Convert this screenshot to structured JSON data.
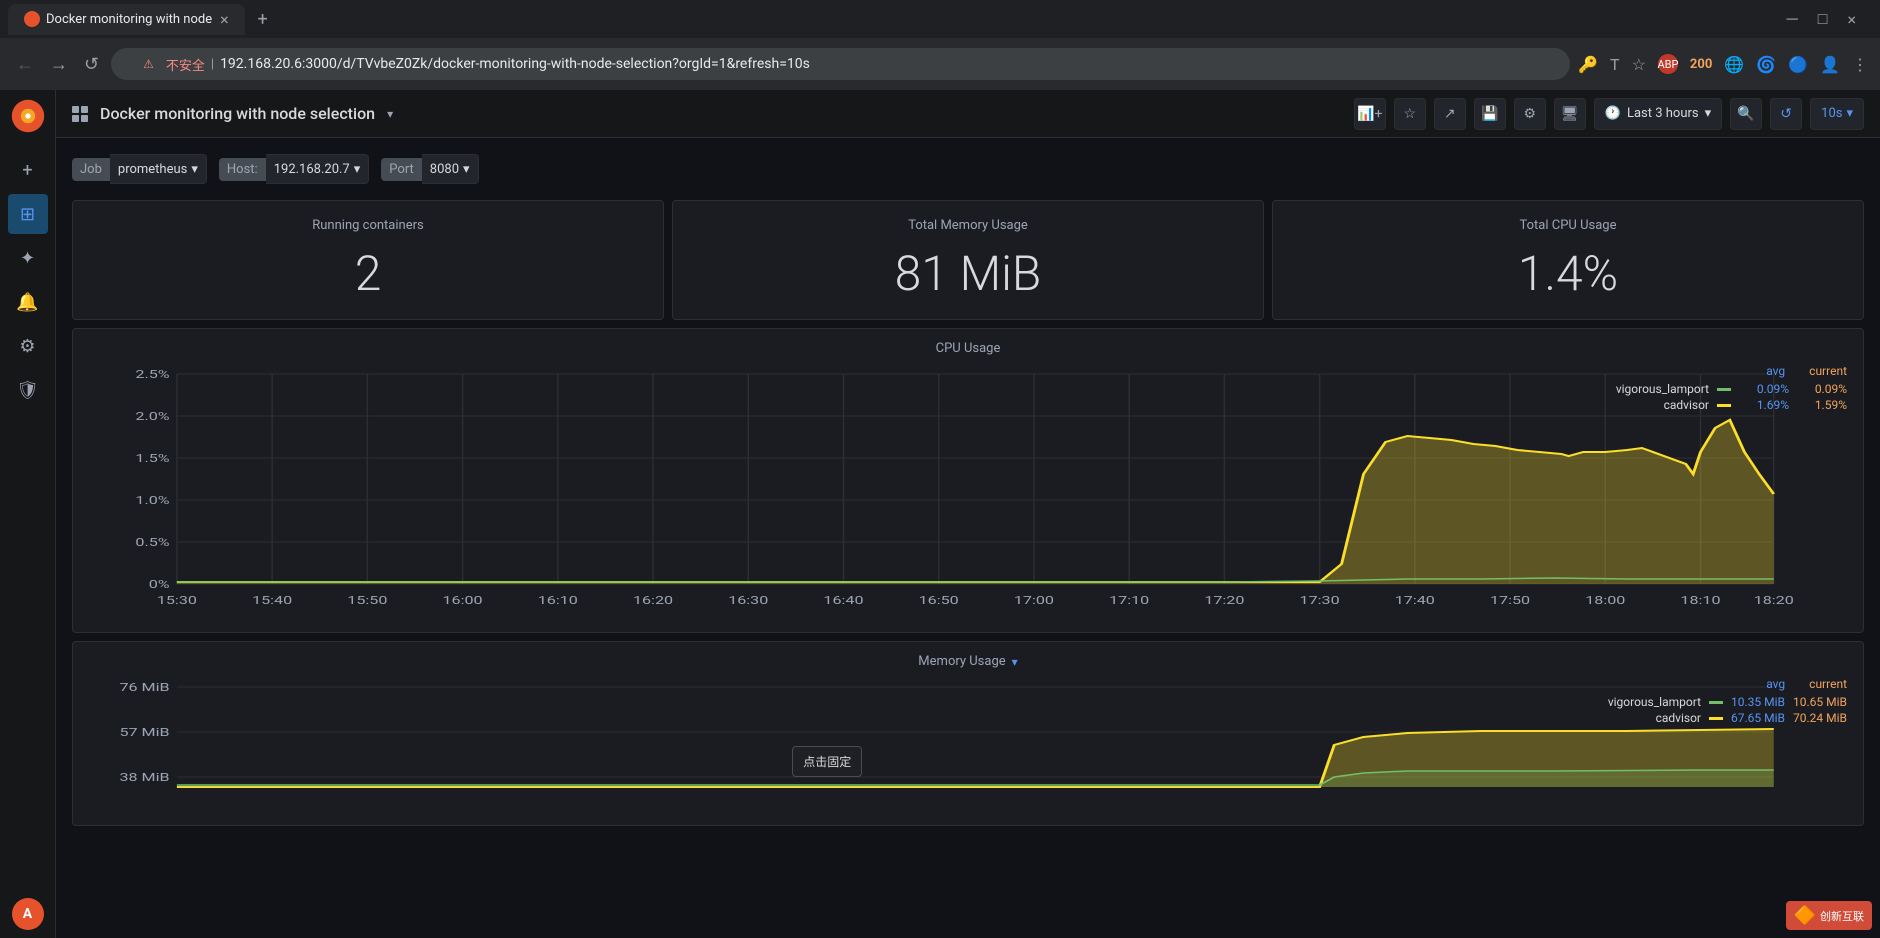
{
  "browser": {
    "tab_title": "Docker monitoring with node",
    "tab_favicon": "●",
    "address_bar": "192.168.20.6:3000/d/TVvbeZ0Zk/docker-monitoring-with-node-selection?orgId=1&refresh=10s",
    "address_warning": "⚠",
    "address_prefix": "不安全",
    "nav_back": "←",
    "nav_forward": "→",
    "nav_reload": "↺"
  },
  "grafana": {
    "logo": "○",
    "dashboard_title": "Docker monitoring with node selection",
    "time_range": "Last 3 hours",
    "refresh_interval": "10s"
  },
  "toolbar": {
    "add_panel_label": "+",
    "star_label": "☆",
    "share_label": "⎤",
    "save_label": "💾",
    "settings_label": "⚙",
    "monitor_label": "🖥",
    "search_label": "🔍",
    "clock_icon": "🕐"
  },
  "variables": {
    "job_label": "Job",
    "job_value": "prometheus",
    "host_label": "Host:",
    "host_value": "192.168.20.7",
    "port_label": "Port",
    "port_value": "8080"
  },
  "stats": {
    "running_containers_title": "Running containers",
    "running_containers_value": "2",
    "memory_usage_title": "Total Memory Usage",
    "memory_usage_value": "81 MiB",
    "cpu_usage_title": "Total CPU Usage",
    "cpu_usage_value": "1.4%"
  },
  "cpu_chart": {
    "title": "CPU Usage",
    "y_labels": [
      "2.5%",
      "2.0%",
      "1.5%",
      "1.0%",
      "0.5%",
      "0%"
    ],
    "x_labels": [
      "15:30",
      "15:40",
      "15:50",
      "16:00",
      "16:10",
      "16:20",
      "16:30",
      "16:40",
      "16:50",
      "17:00",
      "17:10",
      "17:20",
      "17:30",
      "17:40",
      "17:50",
      "18:00",
      "18:10",
      "18:20"
    ],
    "legend": {
      "avg_label": "avg",
      "current_label": "current",
      "series": [
        {
          "name": "vigorous_lamport",
          "color": "green",
          "avg": "0.09%",
          "current": "0.09%"
        },
        {
          "name": "cadvisor",
          "color": "yellow",
          "avg": "1.69%",
          "current": "1.59%"
        }
      ]
    }
  },
  "memory_chart": {
    "title": "Memory Usage",
    "y_labels": [
      "76 MiB",
      "57 MiB",
      "38 MiB"
    ],
    "legend": {
      "avg_label": "avg",
      "current_label": "current",
      "series": [
        {
          "name": "vigorous_lamport",
          "color": "green",
          "avg": "10.35 MiB",
          "current": "10.65 MiB"
        },
        {
          "name": "cadvisor",
          "color": "yellow",
          "avg": "67.65 MiB",
          "current": "70.24 MiB"
        }
      ]
    }
  },
  "sidebar": {
    "items": [
      {
        "label": "Add panel",
        "icon": "+"
      },
      {
        "label": "Dashboard",
        "icon": "⊞"
      },
      {
        "label": "Explore",
        "icon": "✦"
      },
      {
        "label": "Alerting",
        "icon": "🔔"
      },
      {
        "label": "Configuration",
        "icon": "⚙"
      },
      {
        "label": "Shield",
        "icon": "🛡"
      }
    ]
  },
  "watermark": {
    "text": "创新互联"
  },
  "tooltip": {
    "text": "点击固定"
  }
}
